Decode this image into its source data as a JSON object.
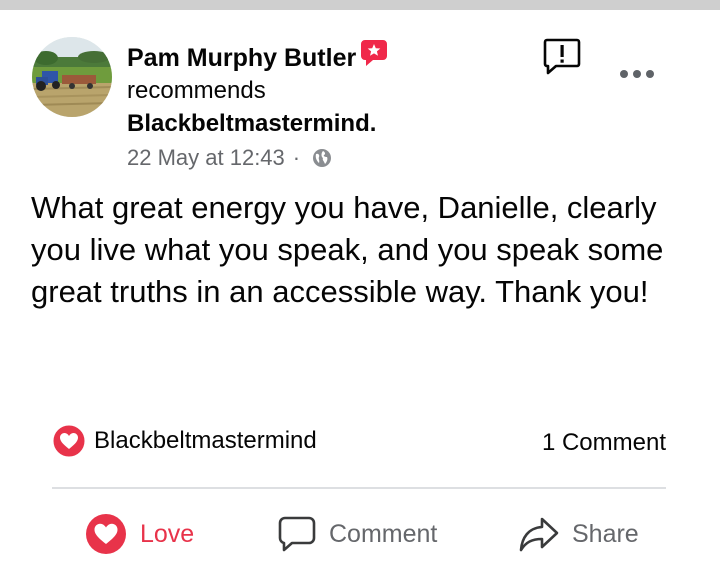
{
  "post": {
    "author_name": "Pam Murphy Butler",
    "action_text": "recommends",
    "page_name": "Blackbeltmastermind.",
    "timestamp": "22 May at 12:43",
    "separator": "·",
    "privacy_icon": "globe-icon",
    "body": "What great energy you have, Danielle, clearly you live what you speak, and you speak some great truths in an accessible way. Thank you!"
  },
  "header_actions": {
    "report_icon": "report-icon",
    "more_icon": "more-options-icon"
  },
  "summary": {
    "reaction_icon": "love-reaction-icon",
    "reacted_by": "Blackbeltmastermind",
    "comment_count": "1 Comment"
  },
  "actions": {
    "love_label": "Love",
    "comment_label": "Comment",
    "share_label": "Share"
  },
  "colors": {
    "love": "#e8334a",
    "secondary_text": "#65676b",
    "badge": "#f0284a",
    "divider": "#dddfe2"
  }
}
